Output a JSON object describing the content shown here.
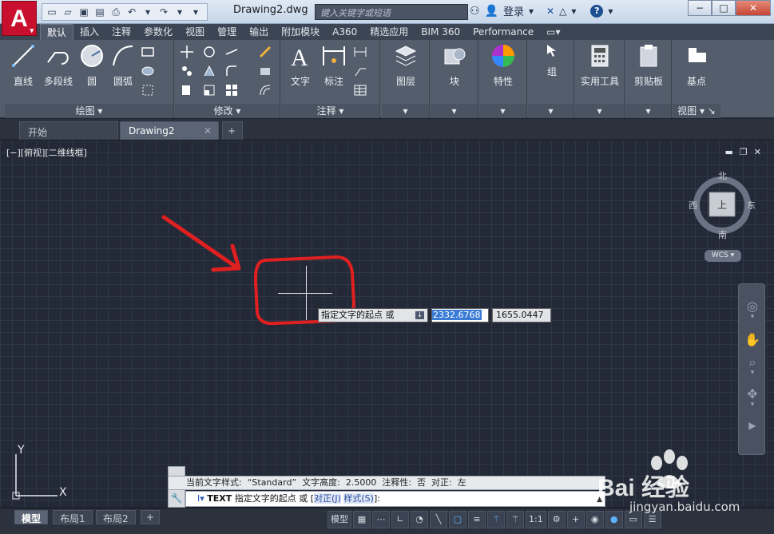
{
  "app": {
    "logo_letter": "A",
    "doc_title": "Drawing2.dwg",
    "search_placeholder": "键入关键字或短语",
    "login_label": "登录",
    "help_label": "?"
  },
  "ribbon_tabs": [
    "默认",
    "插入",
    "注释",
    "参数化",
    "视图",
    "管理",
    "输出",
    "附加模块",
    "A360",
    "精选应用",
    "BIM 360",
    "Performance"
  ],
  "ribbon": {
    "draw_tools": [
      "直线",
      "多段线",
      "圆",
      "圆弧"
    ],
    "draw_group": "绘图",
    "modify_group": "修改",
    "annot_tools": [
      "文字",
      "标注"
    ],
    "annot_group": "注释",
    "layers_label": "图层",
    "block_label": "块",
    "props_label": "特性",
    "group_label": "组",
    "utilities_label": "实用工具",
    "clipboard_label": "剪贴板",
    "base_label": "基点",
    "view_group": "视图"
  },
  "doc_tabs": {
    "start": "开始",
    "drawing": "Drawing2"
  },
  "viewport": {
    "label": "[−][俯视][二维线框]"
  },
  "viewcube": {
    "north": "北",
    "south": "南",
    "east": "东",
    "west": "西",
    "face": "上",
    "wcs": "WCS"
  },
  "dynamic_input": {
    "prompt": "指定文字的起点 或",
    "x_value": "2332.6768",
    "y_value": "1655.0447"
  },
  "ucs": {
    "x_label": "X",
    "y_label": "Y"
  },
  "command": {
    "history": "当前文字样式:  “Standard”  文字高度:  2.5000  注释性:  否  对正:  左",
    "cmd_name": "TEXT",
    "prompt_text": " 指定文字的起点 或 [",
    "option_justify": "对正(J)",
    "option_style": "样式(S)",
    "prompt_end": "]:"
  },
  "layout_tabs": [
    "模型",
    "布局1",
    "布局2"
  ],
  "status": {
    "model_label": "模型",
    "scale": "1:1"
  },
  "watermark": {
    "brand": "Bai  经验",
    "url": "jingyan.baidu.com"
  },
  "colors": {
    "accent_red": "#e02020",
    "autocad_red": "#c8102e",
    "canvas_bg": "#232936"
  }
}
